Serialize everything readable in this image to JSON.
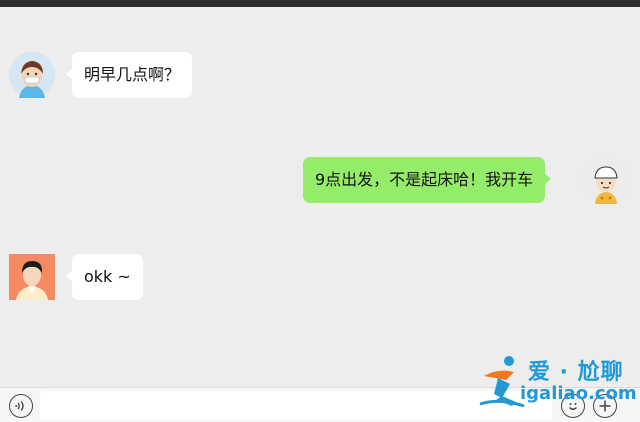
{
  "chat": {
    "messages": [
      {
        "side": "left",
        "sender": "girl",
        "text": "明早几点啊？"
      },
      {
        "side": "right",
        "sender": "boy",
        "text": "9点出发，不是起床哈！我开车"
      },
      {
        "side": "left",
        "sender": "man",
        "text": "okk ~"
      }
    ]
  },
  "input_bar": {
    "voice_icon": "voice-icon",
    "emoji_icon": "emoji-icon",
    "plus_icon": "plus-icon"
  },
  "watermark": {
    "brand_cn": "爱 · 尬聊",
    "domain": "igaliao.com"
  },
  "colors": {
    "chat_bg": "#ededed",
    "bubble_self": "#95ec69",
    "bubble_other": "#ffffff",
    "watermark_blue": "#1f9ad6",
    "watermark_orange": "#f07a1a"
  }
}
